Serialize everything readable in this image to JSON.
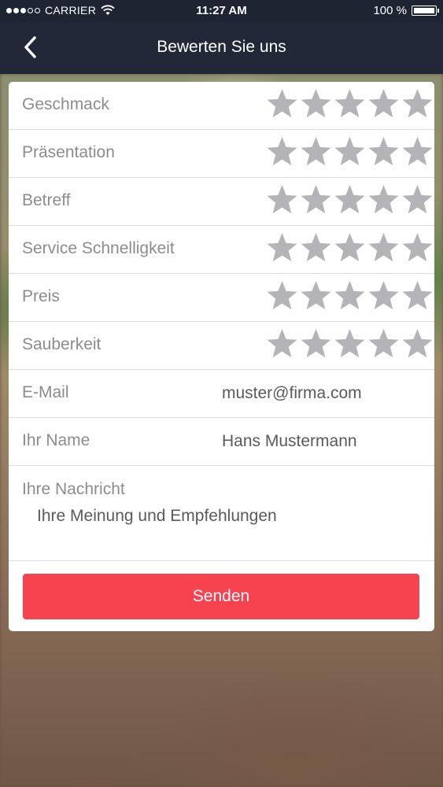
{
  "status_bar": {
    "carrier": "CARRIER",
    "time": "11:27 AM",
    "battery": "100 %",
    "battery_level": 1.0,
    "signal_bars_filled": 3,
    "signal_bars_total": 5
  },
  "nav": {
    "title": "Bewerten Sie uns",
    "back_icon": "chevron-left-icon"
  },
  "ratings": [
    {
      "label": "Geschmack",
      "stars_filled": 0,
      "stars_total": 5
    },
    {
      "label": "Präsentation",
      "stars_filled": 0,
      "stars_total": 5
    },
    {
      "label": "Betreff",
      "stars_filled": 0,
      "stars_total": 5
    },
    {
      "label": "Service Schnelligkeit",
      "stars_filled": 0,
      "stars_total": 5
    },
    {
      "label": "Preis",
      "stars_filled": 0,
      "stars_total": 5
    },
    {
      "label": "Sauberkeit",
      "stars_filled": 0,
      "stars_total": 5
    }
  ],
  "fields": {
    "email": {
      "label": "E-Mail",
      "placeholder": "muster@firma.com"
    },
    "name": {
      "label": "Ihr Name",
      "placeholder": "Hans Mustermann"
    },
    "message": {
      "label": "Ihre Nachricht",
      "placeholder": "Ihre Meinung und Empfehlungen"
    }
  },
  "submit_label": "Senden",
  "colors": {
    "nav_bg": "#232838",
    "star_empty": "#b4b4b8",
    "submit_bg": "#f6434f"
  }
}
